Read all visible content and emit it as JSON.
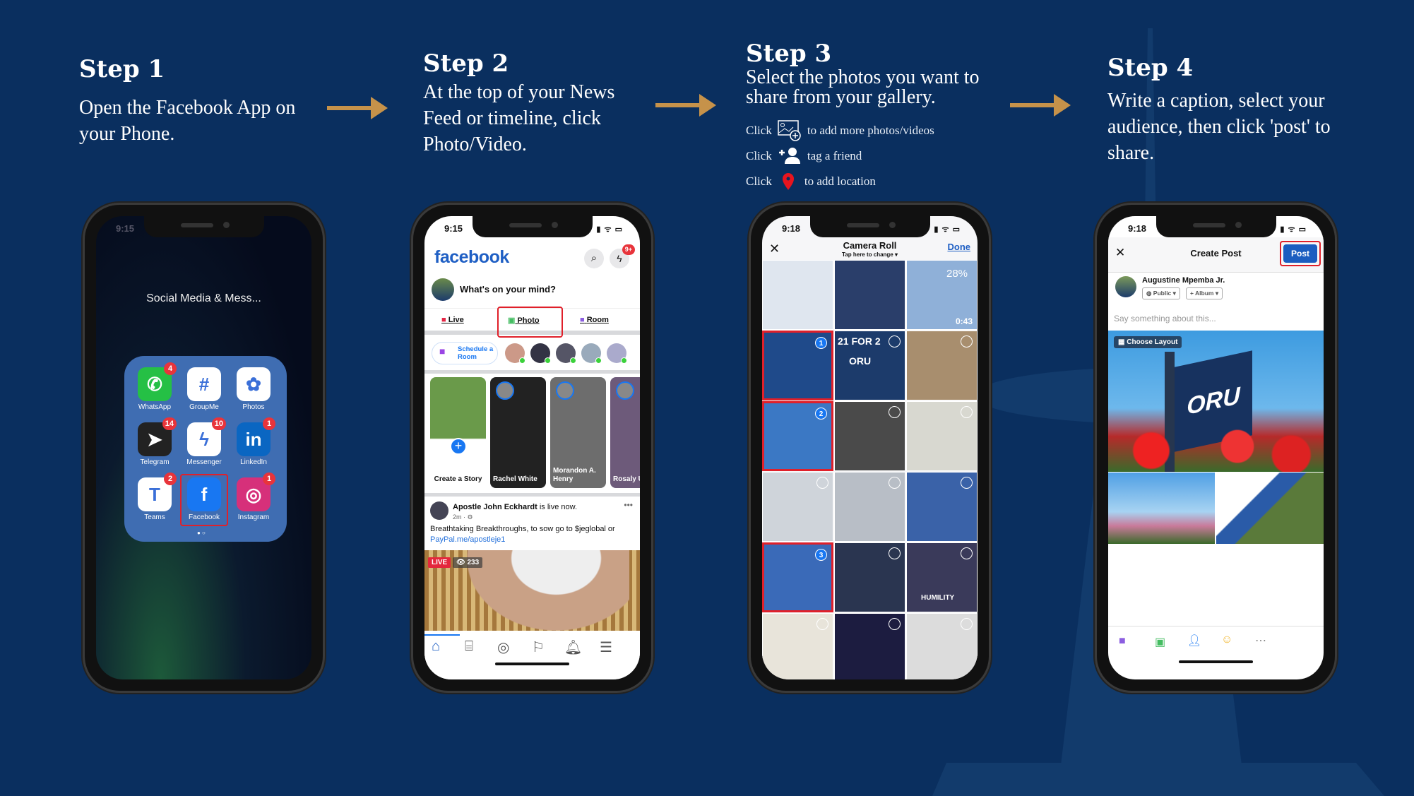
{
  "colors": {
    "background": "#0a2f5f",
    "accent_arrow": "#c6924a",
    "highlight": "#e0202a",
    "facebook_blue": "#1877f2"
  },
  "steps": [
    {
      "title": "Step 1",
      "body": "Open the Facebook App on your Phone."
    },
    {
      "title": "Step 2",
      "body": "At the top of your News Feed or timeline, click Photo/Video."
    },
    {
      "title": "Step 3",
      "body": "Select the photos you want to share from your gallery.",
      "hints": [
        {
          "prefix": "Click",
          "icon": "add-photo-icon",
          "text": "to add more photos/videos"
        },
        {
          "prefix": "Click",
          "icon": "tag-friend-icon",
          "text": "tag a friend"
        },
        {
          "prefix": "Click",
          "icon": "location-pin-icon",
          "text": "to add location"
        }
      ]
    },
    {
      "title": "Step 4",
      "body": "Write a caption, select your audience, then click 'post' to share."
    }
  ],
  "phone1": {
    "time": "9:15",
    "folder_title": "Social Media & Mess...",
    "apps": [
      {
        "label": "WhatsApp",
        "badge": "4",
        "color": "#25c045",
        "glyph": "✆"
      },
      {
        "label": "GroupMe",
        "badge": "",
        "color": "#ffffff",
        "glyph": "#"
      },
      {
        "label": "Photos",
        "badge": "",
        "color": "#ffffff",
        "glyph": "✿"
      },
      {
        "label": "Telegram",
        "badge": "14",
        "color": "#222222",
        "glyph": "➤"
      },
      {
        "label": "Messenger",
        "badge": "10",
        "color": "#ffffff",
        "glyph": "ϟ"
      },
      {
        "label": "LinkedIn",
        "badge": "1",
        "color": "#0a66c2",
        "glyph": "in"
      },
      {
        "label": "Teams",
        "badge": "2",
        "color": "#ffffff",
        "glyph": "T"
      },
      {
        "label": "Facebook",
        "badge": "",
        "color": "#1877f2",
        "glyph": "f"
      },
      {
        "label": "Instagram",
        "badge": "1",
        "color": "#d6307a",
        "glyph": "◎"
      }
    ]
  },
  "phone2": {
    "time": "9:15",
    "logo": "facebook",
    "messenger_badge": "9+",
    "composer_placeholder": "What's on your mind?",
    "actions": [
      "Live",
      "Photo",
      "Room"
    ],
    "schedule_room": "Schedule a Room",
    "stories": [
      "Create a Story",
      "Rachel White",
      "Morandon A. Henry",
      "Rosaly Usuma"
    ],
    "post": {
      "author": "Apostle John Eckhardt",
      "status": " is live now.",
      "meta": "2m · ⚙",
      "text": "Breathtaking Breakthroughs, to sow go to $jeglobal or ",
      "link": "PayPal.me/apostleje1",
      "live_label": "LIVE",
      "viewers": "233"
    }
  },
  "phone3": {
    "time": "9:18",
    "title": "Camera Roll",
    "subtitle": "Tap here to change ▾",
    "done": "Done",
    "video_duration": "0:43",
    "battery_widget": "28%",
    "tile_text": [
      "21 FOR 2",
      "ORU",
      "HUMILITY"
    ],
    "selected": [
      "1",
      "2",
      "3"
    ]
  },
  "phone4": {
    "time": "9:18",
    "title": "Create Post",
    "post_button": "Post",
    "author": "Augustine Mpemba Jr.",
    "audience": "Public ▾",
    "album": "+ Album ▾",
    "caption_placeholder": "Say something about this...",
    "choose_layout": "Choose Layout",
    "banner_text": "ORU"
  }
}
